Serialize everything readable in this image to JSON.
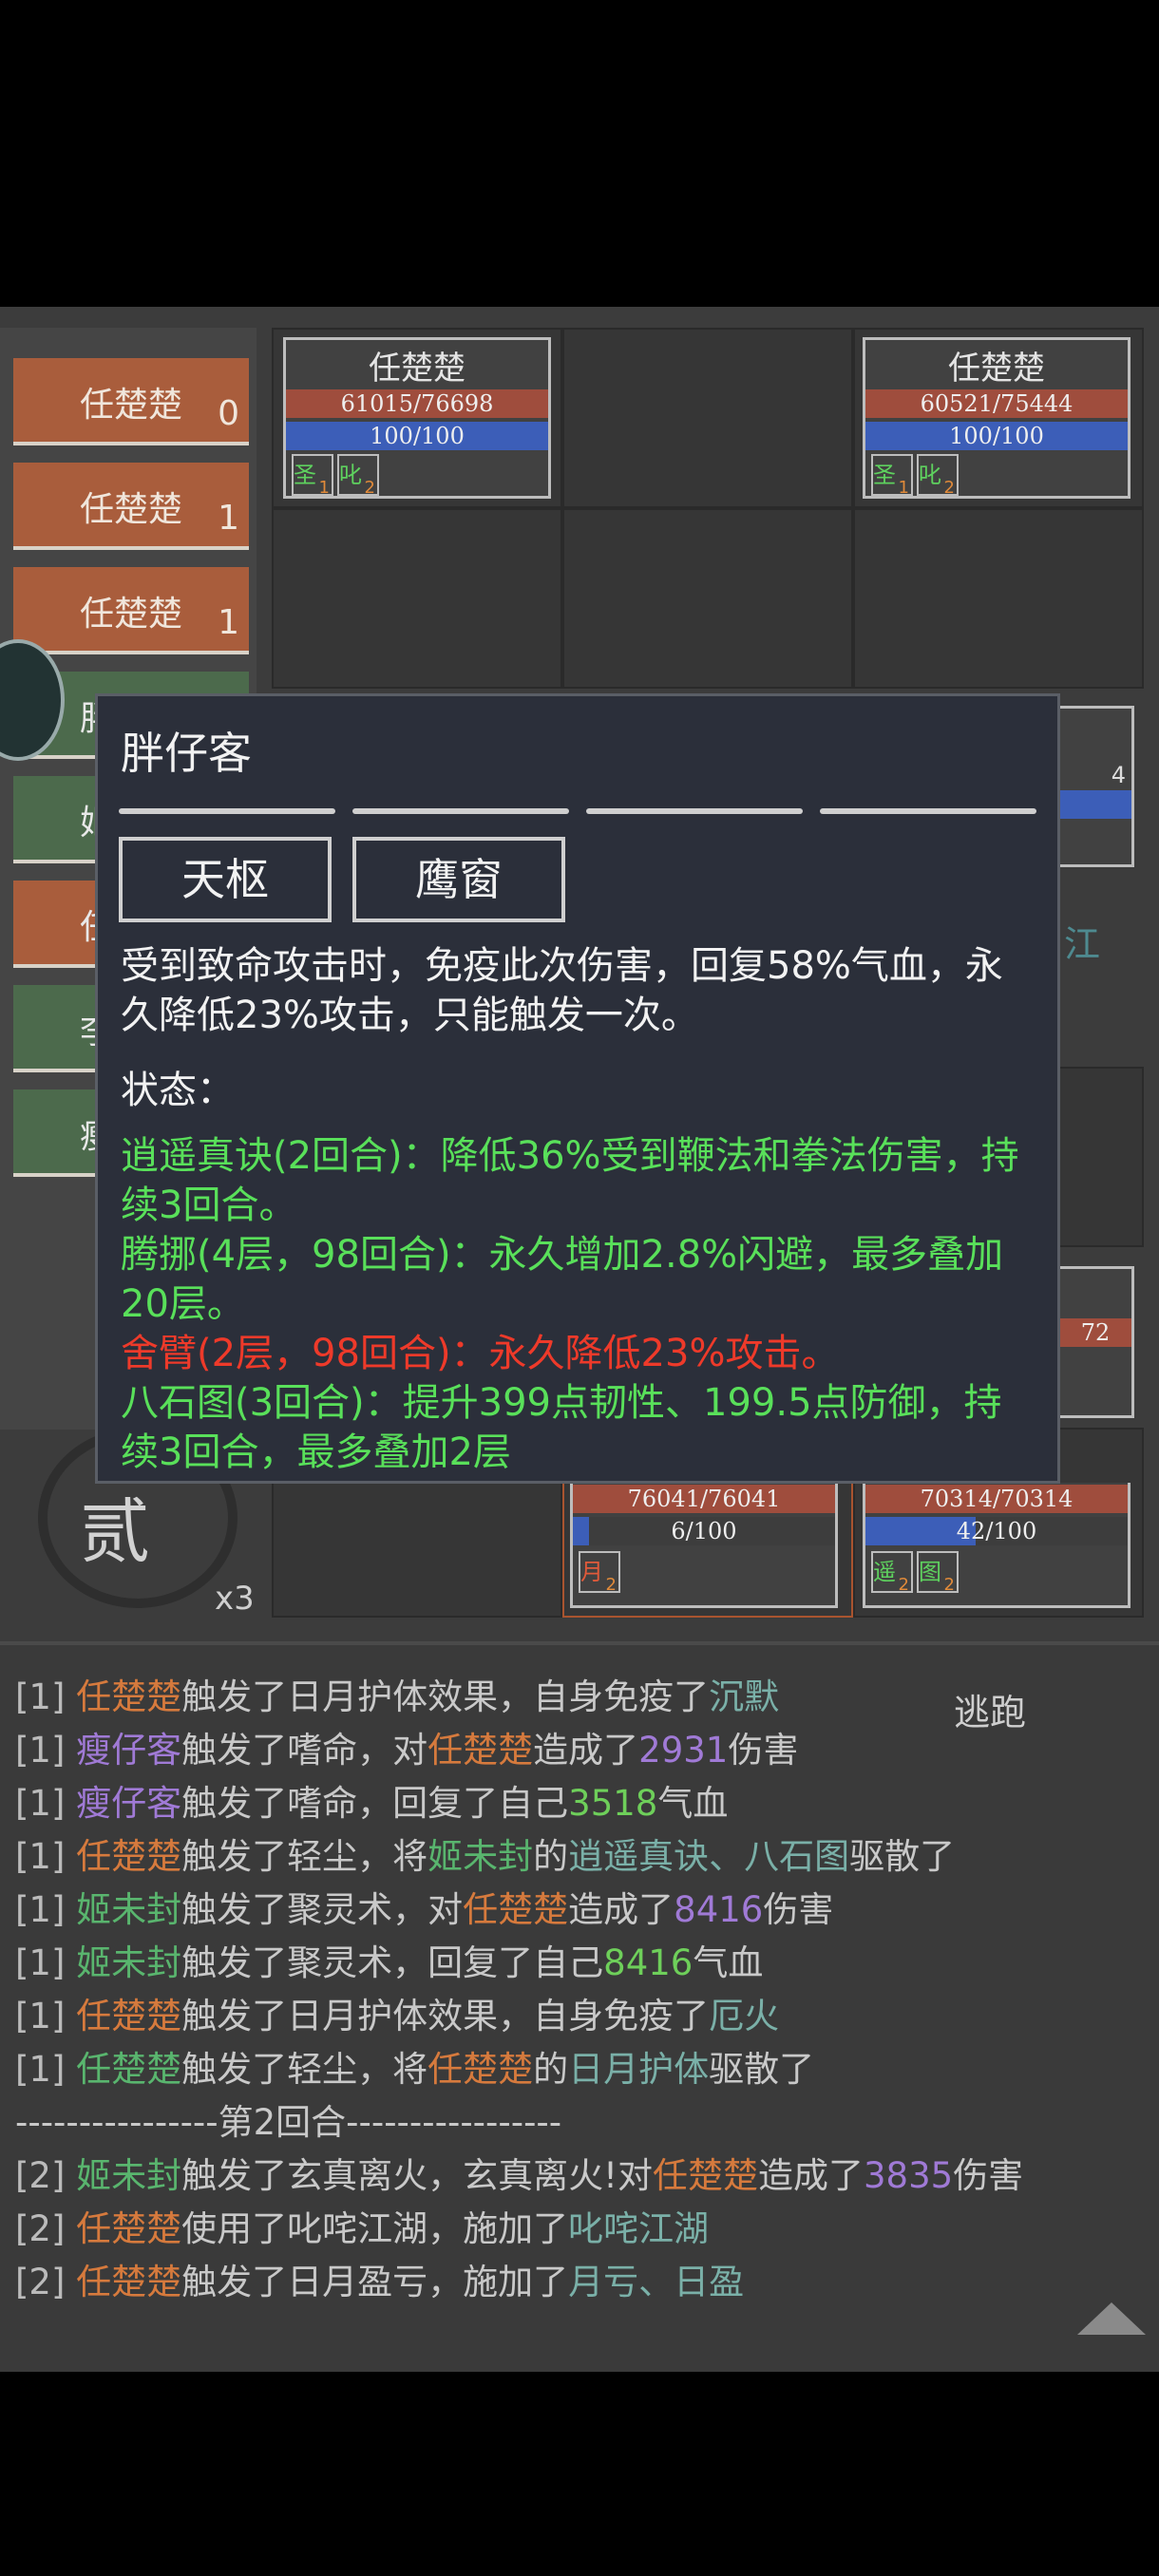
{
  "turn_order": [
    {
      "name": "任楚楚",
      "num": "0"
    },
    {
      "name": "任楚楚",
      "num": "1"
    },
    {
      "name": "任楚楚",
      "num": "1"
    }
  ],
  "partial_turn_labels": [
    "胖",
    "姬",
    "任",
    "李",
    "瘦"
  ],
  "cards": [
    {
      "name": "任楚楚",
      "hp": "61015/76698",
      "mp": "100/100",
      "buffs": [
        {
          "icon": "圣",
          "stack": "1"
        },
        {
          "icon": "叱",
          "stack": "2"
        }
      ]
    },
    {
      "name": "任楚楚",
      "hp": "60521/75444",
      "mp": "100/100",
      "buffs": [
        {
          "icon": "圣",
          "stack": "1"
        },
        {
          "icon": "叱",
          "stack": "2"
        }
      ]
    },
    {
      "name": "",
      "hp": "76041/76041",
      "mp": "6/100",
      "mp_fraction": 0.06,
      "buffs": [
        {
          "icon": "月",
          "stack": "2"
        }
      ]
    },
    {
      "name": "",
      "hp": "70314/70314",
      "mp": "42/100",
      "mp_fraction": 0.42,
      "buffs": [
        {
          "icon": "遥",
          "stack": "2"
        },
        {
          "icon": "图",
          "stack": "2"
        }
      ]
    }
  ],
  "partial_right": {
    "mp": "4",
    "hp": "72",
    "river": "江"
  },
  "battle_round": "贰",
  "speed": "x3",
  "flee_label": "逃跑",
  "tooltip": {
    "name": "胖仔客",
    "tags": [
      "天枢",
      "鹰窗"
    ],
    "desc": "受到致命攻击时，免疫此次伤害，回复58%气血，永久降低23%攻击，只能触发一次。",
    "status_label": "状态：",
    "statuses": [
      {
        "text": "逍遥真诀(2回合)：降低36%受到鞭法和拳法伤害，持续3回合。",
        "color": "#59e05a"
      },
      {
        "text": "腾挪(4层，98回合)：永久增加2.8%闪避，最多叠加20层。",
        "color": "#59e05a"
      },
      {
        "text": "舍臂(2层，98回合)：永久降低23%攻击。",
        "color": "#ee3a2a"
      },
      {
        "text": "八石图(3回合)：提升399点韧性、199.5点防御，持续3回合，最多叠加2层",
        "color": "#59e05a"
      }
    ]
  },
  "log": [
    {
      "prefix": "[1] ",
      "parts": [
        [
          "任楚楚",
          "or"
        ],
        [
          "触发了日月护体效果，自身免疫了",
          ""
        ],
        [
          "沉默",
          "tl"
        ]
      ]
    },
    {
      "prefix": "[1] ",
      "parts": [
        [
          "瘦仔客",
          "pu"
        ],
        [
          "触发了嗜命，对",
          ""
        ],
        [
          "任楚楚",
          "or"
        ],
        [
          "造成了",
          ""
        ],
        [
          "2931",
          "pu"
        ],
        [
          "伤害",
          ""
        ]
      ]
    },
    {
      "prefix": "[1] ",
      "parts": [
        [
          "瘦仔客",
          "pu"
        ],
        [
          "触发了嗜命，回复了自己",
          ""
        ],
        [
          "3518",
          "lg"
        ],
        [
          "气血",
          ""
        ]
      ]
    },
    {
      "prefix": "[1] ",
      "parts": [
        [
          "任楚楚",
          "or"
        ],
        [
          "触发了轻尘，将",
          ""
        ],
        [
          "姬未封",
          "gr"
        ],
        [
          "的",
          ""
        ],
        [
          "逍遥真诀、八石图",
          "tl"
        ],
        [
          "驱散了",
          ""
        ]
      ]
    },
    {
      "prefix": "[1] ",
      "parts": [
        [
          "姬未封",
          "gr"
        ],
        [
          "触发了聚灵术，对",
          ""
        ],
        [
          "任楚楚",
          "or"
        ],
        [
          "造成了",
          ""
        ],
        [
          "8416",
          "pu"
        ],
        [
          "伤害",
          ""
        ]
      ]
    },
    {
      "prefix": "[1] ",
      "parts": [
        [
          "姬未封",
          "gr"
        ],
        [
          "触发了聚灵术，回复了自己",
          ""
        ],
        [
          "8416",
          "lg"
        ],
        [
          "气血",
          ""
        ]
      ]
    },
    {
      "prefix": "[1] ",
      "parts": [
        [
          "任楚楚",
          "or"
        ],
        [
          "触发了日月护体效果，自身免疫了",
          ""
        ],
        [
          "厄火",
          "tl"
        ]
      ]
    },
    {
      "prefix": "[1] ",
      "parts": [
        [
          "任楚楚",
          "gr"
        ],
        [
          "触发了轻尘，将",
          ""
        ],
        [
          "任楚楚",
          "or"
        ],
        [
          "的",
          ""
        ],
        [
          "日月护体",
          "tl"
        ],
        [
          "驱散了",
          ""
        ]
      ]
    },
    {
      "prefix": "",
      "parts": [
        [
          "----------------第2回合-----------------",
          ""
        ]
      ]
    },
    {
      "prefix": "[2] ",
      "parts": [
        [
          "姬未封",
          "gr"
        ],
        [
          "触发了玄真离火，玄真离火!对",
          ""
        ],
        [
          "任楚楚",
          "or"
        ],
        [
          "造成了",
          ""
        ],
        [
          "3835",
          "pu"
        ],
        [
          "伤害",
          ""
        ]
      ]
    },
    {
      "prefix": "[2] ",
      "parts": [
        [
          "任楚楚",
          "or"
        ],
        [
          "使用了叱咤江湖，施加了",
          ""
        ],
        [
          "叱咤江湖",
          "tl"
        ]
      ]
    },
    {
      "prefix": "[2] ",
      "parts": [
        [
          "任楚楚",
          "or"
        ],
        [
          "触发了日月盈亏，施加了",
          ""
        ],
        [
          "月亏、日盈",
          "tl"
        ]
      ]
    }
  ]
}
